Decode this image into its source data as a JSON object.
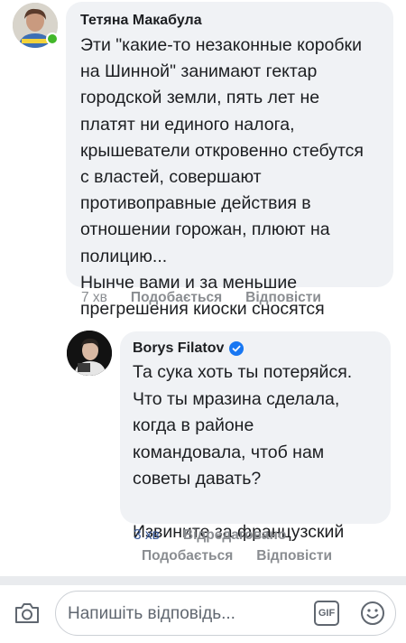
{
  "comments": [
    {
      "author": "Тетяна Макабула",
      "text": "Эти \"какие-то незаконные коробки\nна Шинной\" занимают гектар\nгородской земли, пять лет не\nплатят ни единого налога,\nкрышеватели откровенно стебутся\nс властей, совершают\nпротивоправные действия в\nотношении горожан, плюют на\nполицию...\nНынче вами и за меньшие\nпрегрешения киоски сносятся",
      "time": "7 хв",
      "like_label": "Подобається",
      "reply_label": "Відповісти",
      "online": true
    },
    {
      "author": "Borys Filatov",
      "verified": true,
      "text": "Та сука хоть ты потеряйся.\nЧто ты мразина сделала,\nкогда в районе\nкомандовала, чтоб нам\nсоветы давать?\n\nИзвините за французский",
      "time": "3 хв",
      "edited_label": "Відредаговано",
      "like_label": "Подобається",
      "reply_label": "Відповісти"
    }
  ],
  "composer": {
    "placeholder": "Напишіть відповідь...",
    "gif_label": "GIF"
  },
  "icons": {
    "camera": "camera-icon",
    "gif": "gif-icon",
    "emoji": "smile-icon",
    "verified": "verified-badge-icon"
  },
  "colors": {
    "bubble": "#f0f2f5",
    "online": "#42b72a",
    "verified": "#1877f2",
    "link": "#385898"
  }
}
